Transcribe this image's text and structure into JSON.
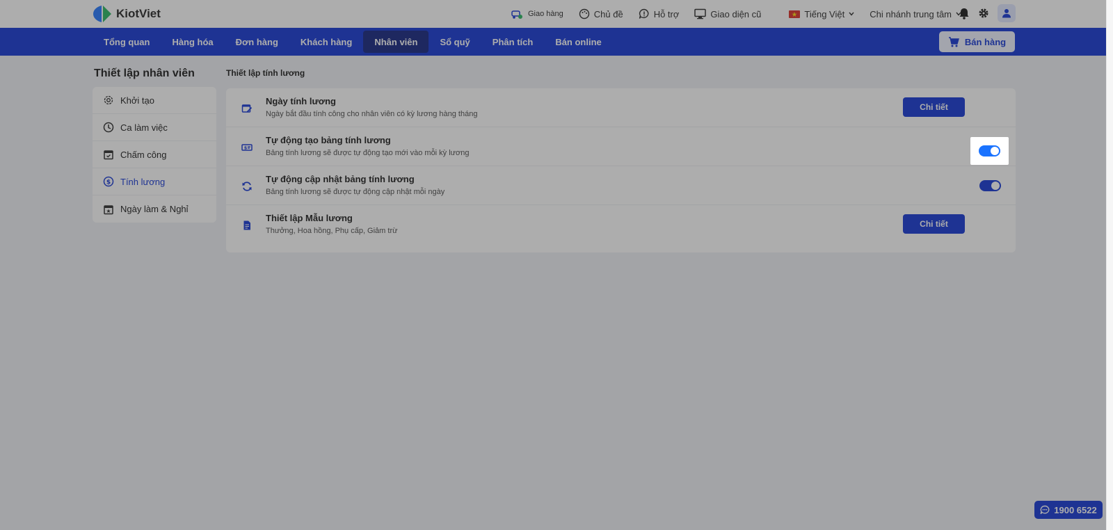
{
  "brand": {
    "name": "KiotViet"
  },
  "topbar": {
    "delivery": "Giao hàng",
    "theme": "Chủ đề",
    "support": "Hỗ trợ",
    "old_ui": "Giao diện cũ",
    "language": "Tiếng Việt",
    "branch": "Chi nhánh trung tâm"
  },
  "nav": {
    "items": [
      {
        "label": "Tổng quan"
      },
      {
        "label": "Hàng hóa"
      },
      {
        "label": "Đơn hàng"
      },
      {
        "label": "Khách hàng"
      },
      {
        "label": "Nhân viên"
      },
      {
        "label": "Sổ quỹ"
      },
      {
        "label": "Phân tích"
      },
      {
        "label": "Bán online"
      }
    ],
    "active_index": 4,
    "sell_label": "Bán hàng"
  },
  "sidebar": {
    "title": "Thiết lập nhân viên",
    "items": [
      {
        "label": "Khởi tạo",
        "icon": "gear-icon"
      },
      {
        "label": "Ca làm việc",
        "icon": "clock-icon"
      },
      {
        "label": "Chấm công",
        "icon": "calendar-check-icon"
      },
      {
        "label": "Tính lương",
        "icon": "dollar-circle-icon"
      },
      {
        "label": "Ngày làm & Nghỉ",
        "icon": "calendar-star-icon"
      }
    ],
    "active_index": 3
  },
  "main": {
    "title": "Thiết lập tính lương",
    "rows": [
      {
        "title": "Ngày tính lương",
        "desc": "Ngày bắt đầu tính công cho nhân viên có kỳ lương hàng tháng",
        "control": "button",
        "button_label": "Chi tiết"
      },
      {
        "title": "Tự động tạo bảng tính lương",
        "desc": "Bảng tính lương sẽ được tự động tạo mới vào mỗi kỳ lương",
        "control": "toggle",
        "on": true
      },
      {
        "title": "Tự động cập nhật bảng tính lương",
        "desc": "Bảng tính lương sẽ được tự động cập nhật mỗi ngày",
        "control": "toggle",
        "on": true
      },
      {
        "title": "Thiết lập Mẫu lương",
        "desc": "Thưởng, Hoa hồng, Phụ cấp, Giảm trừ",
        "control": "button",
        "button_label": "Chi tiết"
      }
    ]
  },
  "hotline": {
    "number": "1900 6522"
  },
  "colors": {
    "primary": "#0a2dd2",
    "primary_dark": "#0a1a7a",
    "toggle_on": "#1a73ff"
  }
}
